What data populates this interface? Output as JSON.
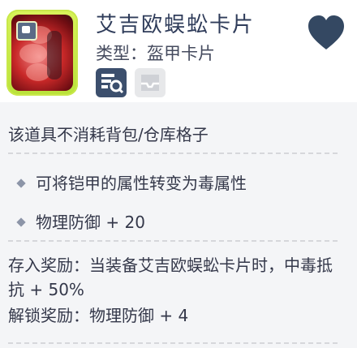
{
  "item": {
    "name": "艾吉欧蜈蚣卡片",
    "type_label": "类型：盔甲卡片"
  },
  "description": "该道具不消耗背包/仓库格子",
  "effects": [
    {
      "text": "可将铠甲的属性转变为毒属性"
    },
    {
      "text": "物理防御 + 20"
    }
  ],
  "rewards": {
    "deposit": "存入奖励：当装备艾吉欧蜈蚣卡片时，中毒抵抗 + 50%",
    "unlock": "解锁奖励：物理防御 + 4"
  },
  "icons": {
    "favorite": "heart-icon",
    "detail": "card-detail-icon",
    "storage": "inbox-icon",
    "badge": "card-type-icon"
  },
  "colors": {
    "frame": "#c6e646",
    "heart": "#344862",
    "detail_button": "#3c4f6d",
    "storage_button": "#e7e8ea"
  }
}
